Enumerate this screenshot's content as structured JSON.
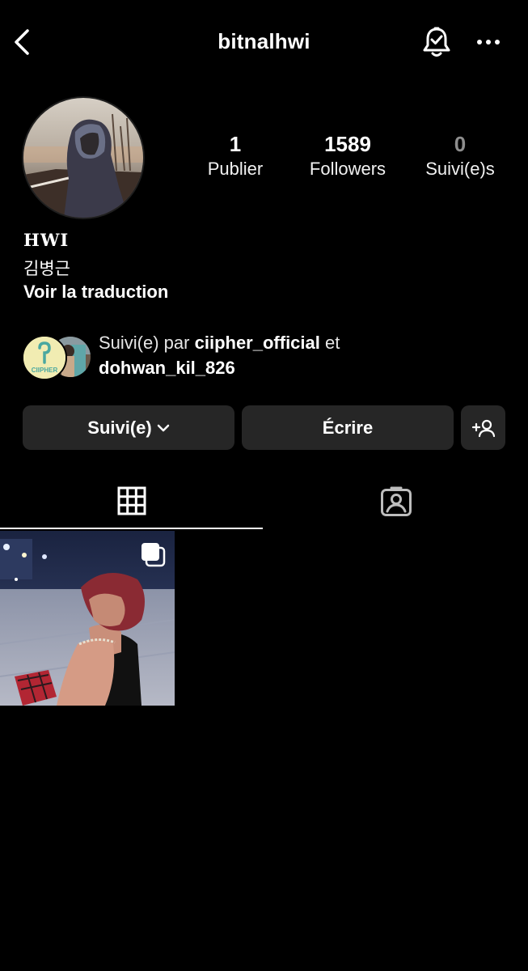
{
  "header": {
    "username": "bitnalhwi",
    "icons": {
      "back": "chevron-left-icon",
      "bell": "bell-check-icon",
      "more": "more-horizontal-icon"
    }
  },
  "profile": {
    "avatar": "profile-photo",
    "stats": [
      {
        "value": "1",
        "label": "Publier"
      },
      {
        "value": "1589",
        "label": "Followers"
      },
      {
        "value": "0",
        "label": "Suivi(e)s"
      }
    ]
  },
  "bio": {
    "name": "HWI",
    "korean": "김병근",
    "translate": "Voir la traduction"
  },
  "followed_by": {
    "prefix": "Suivi(e) par",
    "user1": "ciipher_official",
    "conj": "et",
    "user2": "dohwan_kil_826",
    "logo_text": "CIIPHER"
  },
  "actions": {
    "follow_label": "Suivi(e)",
    "message_label": "Écrire",
    "add_label": "+"
  },
  "tabs": {
    "grid": "grid-icon",
    "tagged": "tagged-person-icon",
    "active": "grid"
  },
  "colors": {
    "background": "#000000",
    "button": "#262626",
    "muted": "#8e8e8e",
    "text": "#ffffff"
  }
}
